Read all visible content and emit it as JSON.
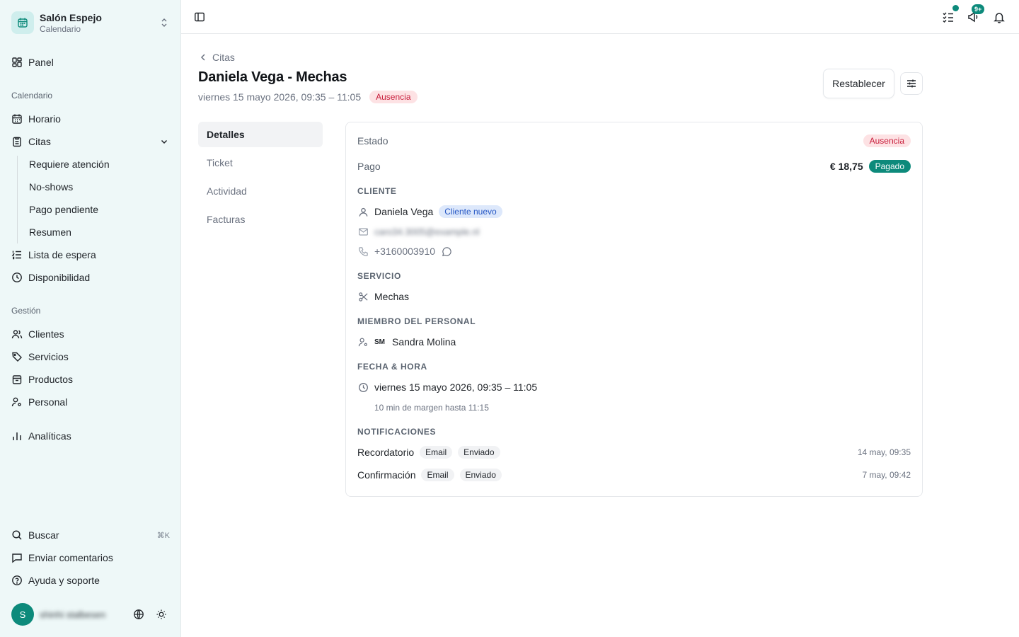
{
  "brand": {
    "name": "Salón Espejo",
    "subtitle": "Calendario"
  },
  "sidebar": {
    "panel": "Panel",
    "section_calendar": "Calendario",
    "horario": "Horario",
    "citas": "Citas",
    "citas_sub": [
      "Requiere atención",
      "No-shows",
      "Pago pendiente",
      "Resumen"
    ],
    "lista_espera": "Lista de espera",
    "disponibilidad": "Disponibilidad",
    "section_gestion": "Gestión",
    "clientes": "Clientes",
    "servicios": "Servicios",
    "productos": "Productos",
    "personal": "Personal",
    "analiticas": "Analíticas",
    "buscar": "Buscar",
    "buscar_shortcut": "⌘K",
    "comentarios": "Enviar comentarios",
    "ayuda": "Ayuda y soporte",
    "user_initial": "S",
    "user_name": "shinhi stalbesen"
  },
  "topbar": {
    "notifications_count": "9+"
  },
  "page": {
    "back_label": "Citas",
    "title": "Daniela Vega - Mechas",
    "subtitle": "viernes 15 mayo 2026, 09:35 – 11:05",
    "status_badge": "Ausencia",
    "reset_button": "Restablecer"
  },
  "tabs": [
    "Detalles",
    "Ticket",
    "Actividad",
    "Facturas"
  ],
  "details": {
    "estado_label": "Estado",
    "estado_value": "Ausencia",
    "pago_label": "Pago",
    "pago_amount": "€ 18,75",
    "pago_status": "Pagado",
    "cliente_heading": "CLIENTE",
    "cliente_name": "Daniela Vega",
    "cliente_badge": "Cliente nuevo",
    "cliente_email": "caro34.3005@example.nl",
    "cliente_phone": "+3160003910",
    "servicio_heading": "SERVICIO",
    "servicio_name": "Mechas",
    "personal_heading": "MIEMBRO DEL PERSONAL",
    "personal_initials": "SM",
    "personal_name": "Sandra Molina",
    "fecha_heading": "FECHA & HORA",
    "fecha_value": "viernes 15 mayo 2026, 09:35 – 11:05",
    "fecha_margin": "10 min de margen hasta 11:15",
    "notif_heading": "NOTIFICACIONES",
    "notifications": [
      {
        "type": "Recordatorio",
        "channel": "Email",
        "status": "Enviado",
        "time": "14 may, 09:35"
      },
      {
        "type": "Confirmación",
        "channel": "Email",
        "status": "Enviado",
        "time": "7 may, 09:42"
      }
    ]
  },
  "colors": {
    "accent": "#0d8a7b",
    "sidebar_bg": "#eef8f8",
    "danger": "#c81e3c"
  }
}
